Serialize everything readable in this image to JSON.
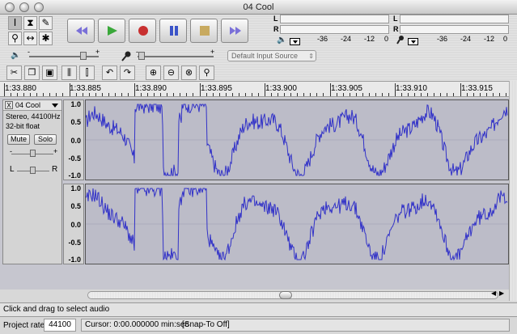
{
  "window": {
    "title": "04 Cool"
  },
  "tools": {
    "row1": [
      "select-tool",
      "envelope-tool",
      "draw-tool"
    ],
    "row2": [
      "zoom-tool",
      "timeshift-tool",
      "multi-tool"
    ]
  },
  "transport": {
    "buttons": [
      "skip-start",
      "play",
      "record",
      "pause",
      "stop",
      "skip-end"
    ]
  },
  "meters": {
    "play_scale": [
      "-36",
      "-24",
      "-12",
      "0"
    ],
    "rec_scale": [
      "-36",
      "-24",
      "-12",
      "0"
    ],
    "left_label": "L",
    "right_label": "R"
  },
  "mixer": {
    "minus": "-",
    "plus": "+",
    "input_source": "Default Input Source",
    "output_volume_level": 0.78,
    "input_volume_level": 0.05
  },
  "ruler": {
    "labels": [
      "1:33.880",
      "1:33.885",
      "1:33.890",
      "1:33.895",
      "1:33.900",
      "1:33.905",
      "1:33.910",
      "1:33.915"
    ]
  },
  "track": {
    "name": "04 Cool",
    "close": "X",
    "info1": "Stereo, 44100Hz",
    "info2": "32-bit float",
    "mute": "Mute",
    "solo": "Solo",
    "pan_left": "L",
    "pan_right": "R",
    "gain_minus": "-",
    "gain_plus": "+",
    "y_labels": [
      "1.0",
      "0.5",
      "0.0",
      "-0.5",
      "-1.0"
    ]
  },
  "status": {
    "message": "Click and drag to select audio",
    "project_rate_label": "Project rate:",
    "project_rate": "44100",
    "cursor": "Cursor: 0:00.000000 min:sec",
    "snap": "[Snap-To Off]"
  },
  "colors": {
    "waveform": "#3232c8",
    "background": "#bcbcc8",
    "accent": "#5b6fd6"
  }
}
